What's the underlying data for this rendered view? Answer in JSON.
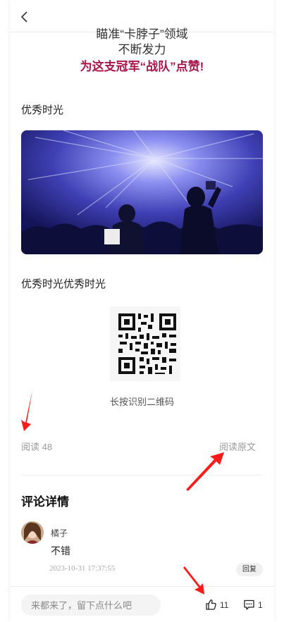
{
  "headline": {
    "line1": "瞄准“卡脖子”领域",
    "line2": "不断发力",
    "line3": "为这支冠军“战队”点赞!"
  },
  "section1_title": "优秀时光",
  "section2_title": "优秀时光优秀时光",
  "qr_caption": "长按识别二维码",
  "stats": {
    "read_count": "阅读 48",
    "read_original": "阅读原文"
  },
  "comments": {
    "title": "评论详情",
    "items": [
      {
        "user": "橘子",
        "text": "不错",
        "time": "2023-10-31 17:37:55",
        "reply_label": "回复"
      }
    ]
  },
  "bottom_bar": {
    "input_placeholder": "来都来了，留下点什么吧",
    "like_count": "11",
    "comment_count": "1"
  },
  "colors": {
    "accent": "#a8174a",
    "annotation_arrow": "#ff1a1a"
  },
  "icons": [
    "back-icon",
    "thumbs-up-icon",
    "comment-icon"
  ]
}
